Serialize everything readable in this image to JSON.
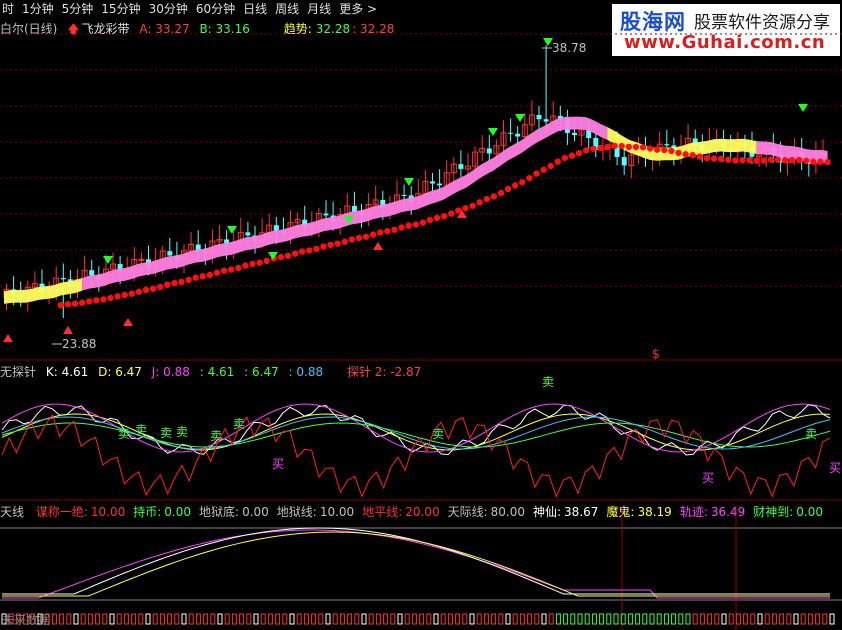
{
  "toolbar": {
    "items": [
      "时",
      "1分钟",
      "5分钟",
      "15分钟",
      "30分钟",
      "60分钟",
      "日线",
      "周线",
      "月线",
      "更多 >"
    ]
  },
  "panel1": {
    "title": "白尔(日线)",
    "indicator_name": "飞龙彩带",
    "a_label": "A: 33.27",
    "b_label": "B: 33.16",
    "trend_label": "趋势:",
    "trend_v1": "32.28",
    "trend_v2": ": 32.28",
    "high_label": "38.78",
    "low_label": "23.88",
    "dollar": "$"
  },
  "panel2": {
    "name": "无探针",
    "k": "K: 4.61",
    "d": "D: 6.47",
    "j": "J: 0.88",
    "v1": ": 4.61",
    "v2": ": 6.47",
    "v3": ": 0.88",
    "probe2": "探针 2: -2.87",
    "sell_label": "卖",
    "buy_label": "买"
  },
  "panel3": {
    "name": "天线",
    "items": [
      {
        "label": "谋称一绝:",
        "value": "10.00",
        "color": "#ff3030"
      },
      {
        "label": "持币:",
        "value": "0.00",
        "color": "#40ff40"
      },
      {
        "label": "地狱底:",
        "value": "0.00",
        "color": "#c0c0c0"
      },
      {
        "label": "地狱线:",
        "value": "10.00",
        "color": "#c0c0c0"
      },
      {
        "label": "地平线:",
        "value": "20.00",
        "color": "#ff3030"
      },
      {
        "label": "天际线:",
        "value": "80.00",
        "color": "#c0c0c0"
      },
      {
        "label": "神仙:",
        "value": "38.67",
        "color": "#ffffff"
      },
      {
        "label": "魔鬼:",
        "value": "38.19",
        "color": "#ffff40"
      },
      {
        "label": "轨迹:",
        "value": "36.49",
        "color": "#ff40ff"
      },
      {
        "label": "财神到:",
        "value": "0.00",
        "color": "#40ff40"
      }
    ],
    "footer": "未来数据"
  },
  "logo": {
    "name": "股海网",
    "slogan": "股票软件资源分享",
    "url": "www.Guhai.com.cn"
  },
  "colors": {
    "up": "#ff3232",
    "down": "#54ffff",
    "ribbon_pink": "#ff80e0",
    "ribbon_yellow": "#ffff60",
    "dots": "#ff1010",
    "grid": "#800000"
  },
  "chart_data": {
    "type": "candlestick",
    "price_high_marker": 38.78,
    "price_low_marker": 23.88,
    "ma_values": {
      "A": 33.27,
      "B": 33.16,
      "trend": 32.28
    }
  }
}
